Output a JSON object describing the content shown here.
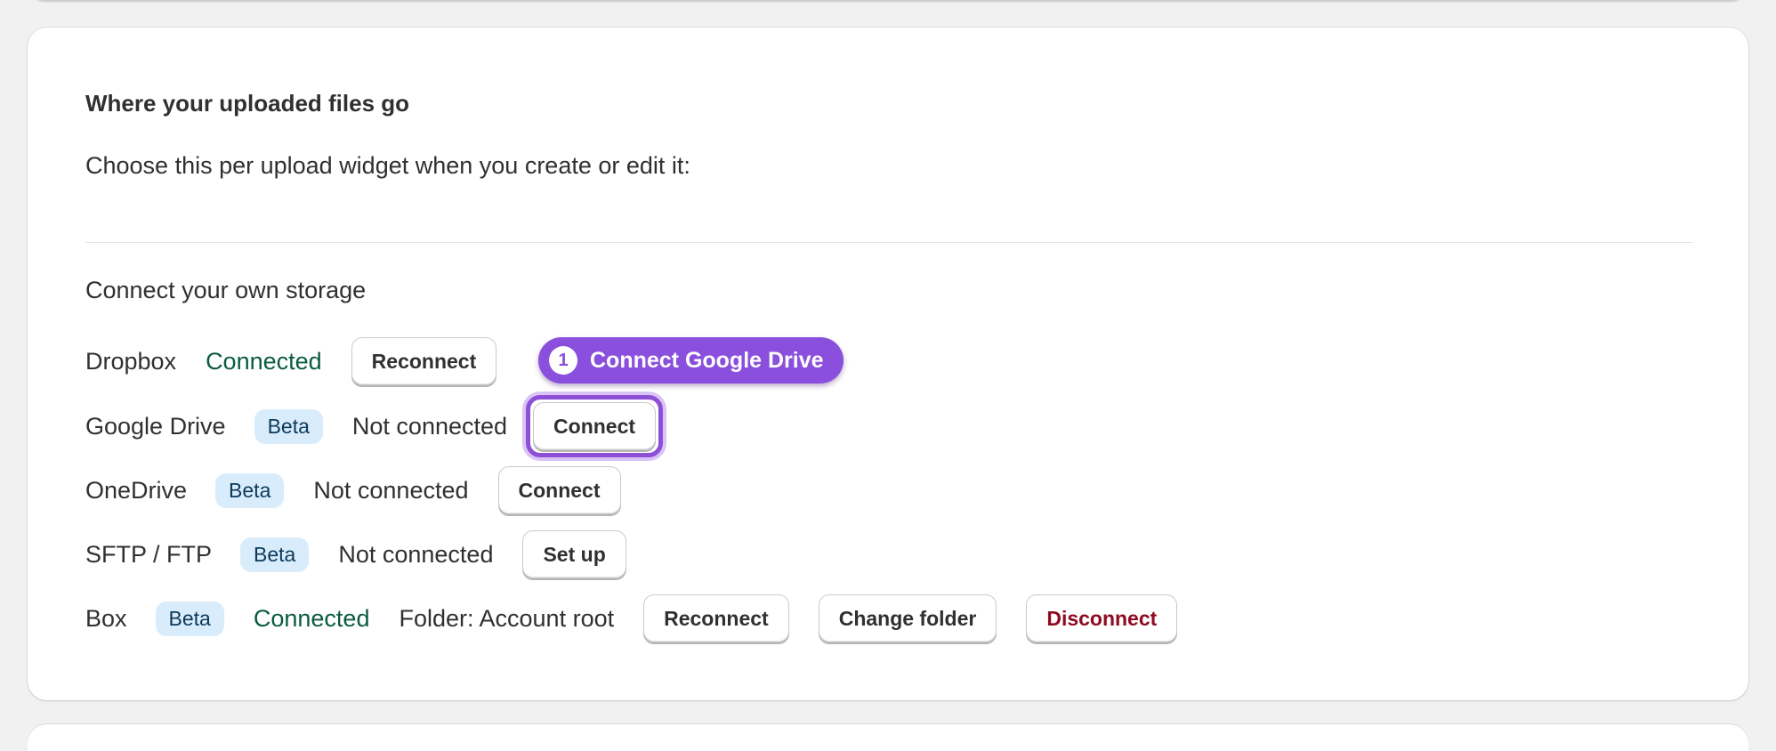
{
  "section": {
    "heading": "Where your uploaded files go",
    "subtext": "Choose this per upload widget when you create or edit it:",
    "storage_title": "Connect your own storage"
  },
  "providers": [
    {
      "name": "Dropbox",
      "badge": "",
      "status": "Connected",
      "buttons": [
        "Reconnect"
      ]
    },
    {
      "name": "Google Drive",
      "badge": "Beta",
      "status": "Not connected",
      "buttons": [
        "Connect"
      ]
    },
    {
      "name": "OneDrive",
      "badge": "Beta",
      "status": "Not connected",
      "buttons": [
        "Connect"
      ]
    },
    {
      "name": "SFTP / FTP",
      "badge": "Beta",
      "status": "Not connected",
      "buttons": [
        "Set up"
      ]
    },
    {
      "name": "Box",
      "badge": "Beta",
      "status": "Connected",
      "folder": "Folder: Account root",
      "buttons": [
        "Reconnect",
        "Change folder",
        "Disconnect"
      ]
    }
  ],
  "callout": {
    "step": "1",
    "label": "Connect Google Drive"
  },
  "colors": {
    "accent": "#8a4fdc",
    "connected": "#0a5c3e",
    "danger": "#8e0b21",
    "badge_bg": "#d9ecfb"
  }
}
